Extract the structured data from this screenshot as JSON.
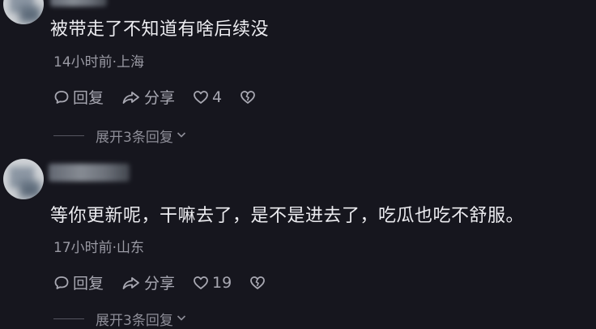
{
  "comments": [
    {
      "text": "被带走了不知道有啥后续没",
      "meta": "14小时前·上海",
      "reply_label": "回复",
      "share_label": "分享",
      "like_count": "4",
      "expand_label": "展开3条回复"
    },
    {
      "text": "等你更新呢，干嘛去了，是不是进去了，吃瓜也吃不舒服。",
      "meta": "17小时前·山东",
      "reply_label": "回复",
      "share_label": "分享",
      "like_count": "19",
      "expand_label": "展开3条回复"
    }
  ],
  "icons": {
    "reply": "comment-bubble-icon",
    "share": "share-arrow-icon",
    "like": "heart-icon",
    "dislike": "broken-heart-icon",
    "expand": "chevron-down-icon"
  },
  "colors": {
    "background": "#16161e",
    "text": "#ececf0",
    "meta": "#9a9aa4"
  }
}
